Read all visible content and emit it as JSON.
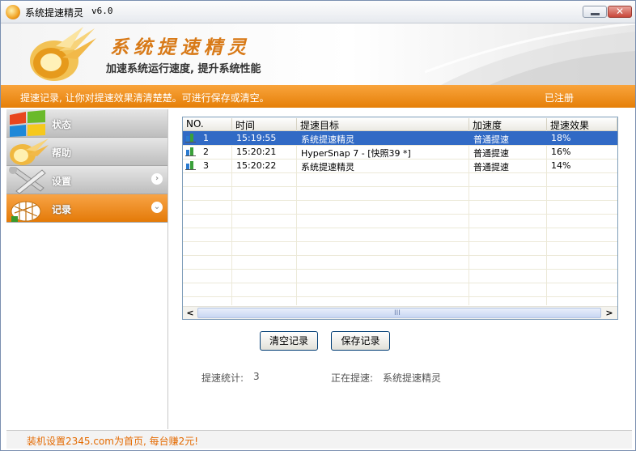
{
  "window": {
    "title": "系统提速精灵",
    "version": "v6.0"
  },
  "header": {
    "brand_title": "系统提速精灵",
    "brand_subtitle": "加速系统运行速度, 提升系统性能"
  },
  "banner": {
    "text": "提速记录, 让你对提速效果清清楚楚。可进行保存或清空。",
    "status": "已注册"
  },
  "sidebar": {
    "items": [
      {
        "label": "状态",
        "icon": "windows-flag-icon",
        "active": false
      },
      {
        "label": "帮助",
        "icon": "flame-icon",
        "active": false
      },
      {
        "label": "设置",
        "icon": "wrench-screwdriver-icon",
        "active": false,
        "arrow": "›"
      },
      {
        "label": "记录",
        "icon": "net-record-icon",
        "active": true,
        "arrow": "⌄"
      }
    ]
  },
  "table": {
    "columns": [
      "NO.",
      "时间",
      "提速目标",
      "加速度",
      "提速效果"
    ],
    "rows": [
      {
        "no": "1",
        "time": "15:19:55",
        "target": "系统提速精灵",
        "speed": "普通提速",
        "effect": "18%"
      },
      {
        "no": "2",
        "time": "15:20:21",
        "target": "HyperSnap 7 - [快照39 *]",
        "speed": "普通提速",
        "effect": "16%"
      },
      {
        "no": "3",
        "time": "15:20:22",
        "target": "系统提速精灵",
        "speed": "普通提速",
        "effect": "14%"
      }
    ],
    "selected_row": 0,
    "scroll": {
      "left": "<",
      "right": ">",
      "grip": "III"
    }
  },
  "buttons": {
    "clear": "清空记录",
    "save": "保存记录"
  },
  "stats": {
    "count_label": "提速统计:",
    "count_value": "3",
    "current_label": "正在提速:",
    "current_value": "系统提速精灵"
  },
  "footer": {
    "link": "装机设置2345.com为首页, 每台赚2元!"
  },
  "colors": {
    "accent": "#f08a14",
    "selection": "#316ac5",
    "footer_link": "#e46a00"
  }
}
